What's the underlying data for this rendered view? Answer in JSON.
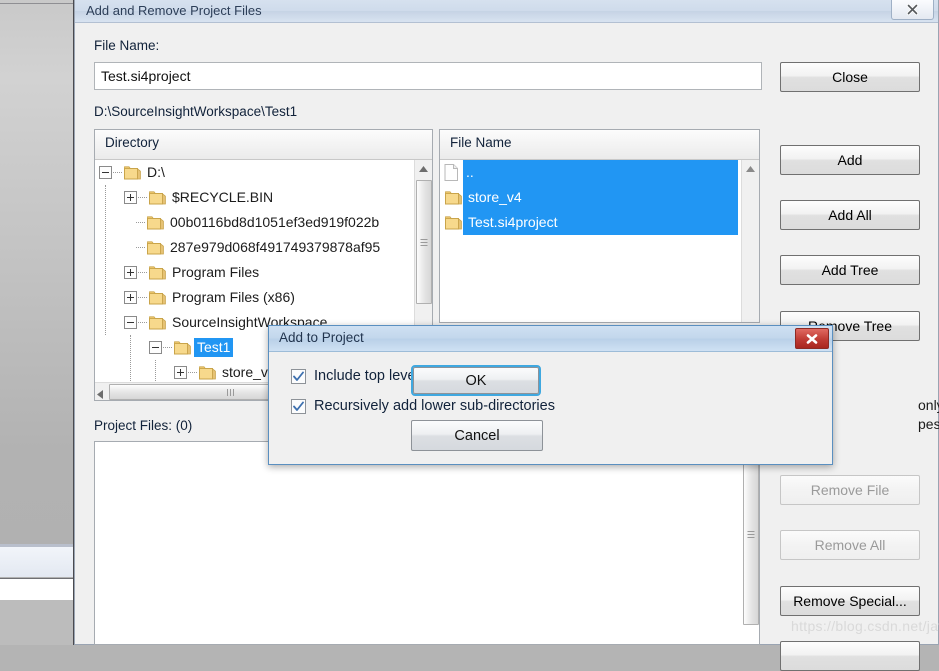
{
  "window": {
    "title": "Add and Remove Project Files",
    "close_icon": "close-x-icon"
  },
  "form": {
    "file_name_label": "File Name:",
    "file_name_value": "Test.si4project",
    "file_name_placeholder": "",
    "current_path": "D:\\SourceInsightWorkspace\\Test1",
    "project_files_label": "Project Files: (0)"
  },
  "directory_pane": {
    "header": "Directory",
    "items": [
      {
        "label": "D:\\",
        "depth": 0,
        "toggle": "minus",
        "icon": "folder-icon",
        "selected": false
      },
      {
        "label": "$RECYCLE.BIN",
        "depth": 1,
        "toggle": "plus",
        "icon": "folder-icon",
        "selected": false
      },
      {
        "label": "00b0116bd8d1051ef3ed919f022b",
        "depth": 1,
        "toggle": "none",
        "icon": "folder-icon",
        "selected": false
      },
      {
        "label": "287e979d068f491749379878af95",
        "depth": 1,
        "toggle": "none",
        "icon": "folder-icon",
        "selected": false
      },
      {
        "label": "Program Files",
        "depth": 1,
        "toggle": "plus",
        "icon": "folder-icon",
        "selected": false
      },
      {
        "label": "Program Files (x86)",
        "depth": 1,
        "toggle": "plus",
        "icon": "folder-icon",
        "selected": false
      },
      {
        "label": "SourceInsightWorkspace",
        "depth": 1,
        "toggle": "minus",
        "icon": "folder-icon",
        "selected": false
      },
      {
        "label": "Test1",
        "depth": 2,
        "toggle": "minus",
        "icon": "folder-icon",
        "selected": true
      },
      {
        "label": "store_v4",
        "depth": 3,
        "toggle": "plus",
        "icon": "folder-icon",
        "selected": false
      }
    ]
  },
  "file_pane": {
    "header": "File Name",
    "items": [
      {
        "label": "..",
        "icon": "file-icon",
        "selected": true
      },
      {
        "label": "store_v4",
        "icon": "folder-icon",
        "selected": true
      },
      {
        "label": "Test.si4project",
        "icon": "folder-icon",
        "selected": true
      }
    ]
  },
  "buttons": {
    "close": "Close",
    "add": "Add",
    "add_all": "Add All",
    "add_tree": "Add Tree",
    "remove_tree": "Remove Tree",
    "remove_file": "Remove File",
    "remove_all": "Remove All",
    "remove_special": "Remove Special..."
  },
  "obscured_text": {
    "line1": "only known",
    "line2": "pes"
  },
  "modal": {
    "title": "Add to Project",
    "close_icon": "close-x-icon",
    "checkboxes": [
      {
        "label": "Include top level sub-directories",
        "checked": true
      },
      {
        "label": "Recursively add lower sub-directories",
        "checked": true
      }
    ],
    "ok": "OK",
    "cancel": "Cancel"
  },
  "watermark": "https://blog.csdn.net/javadamn",
  "colors": {
    "selection_blue": "#2196f3",
    "title_blue": "#2c3e58",
    "focus_ring": "#3fa8e0",
    "modal_close_red": "#bf3b34"
  }
}
